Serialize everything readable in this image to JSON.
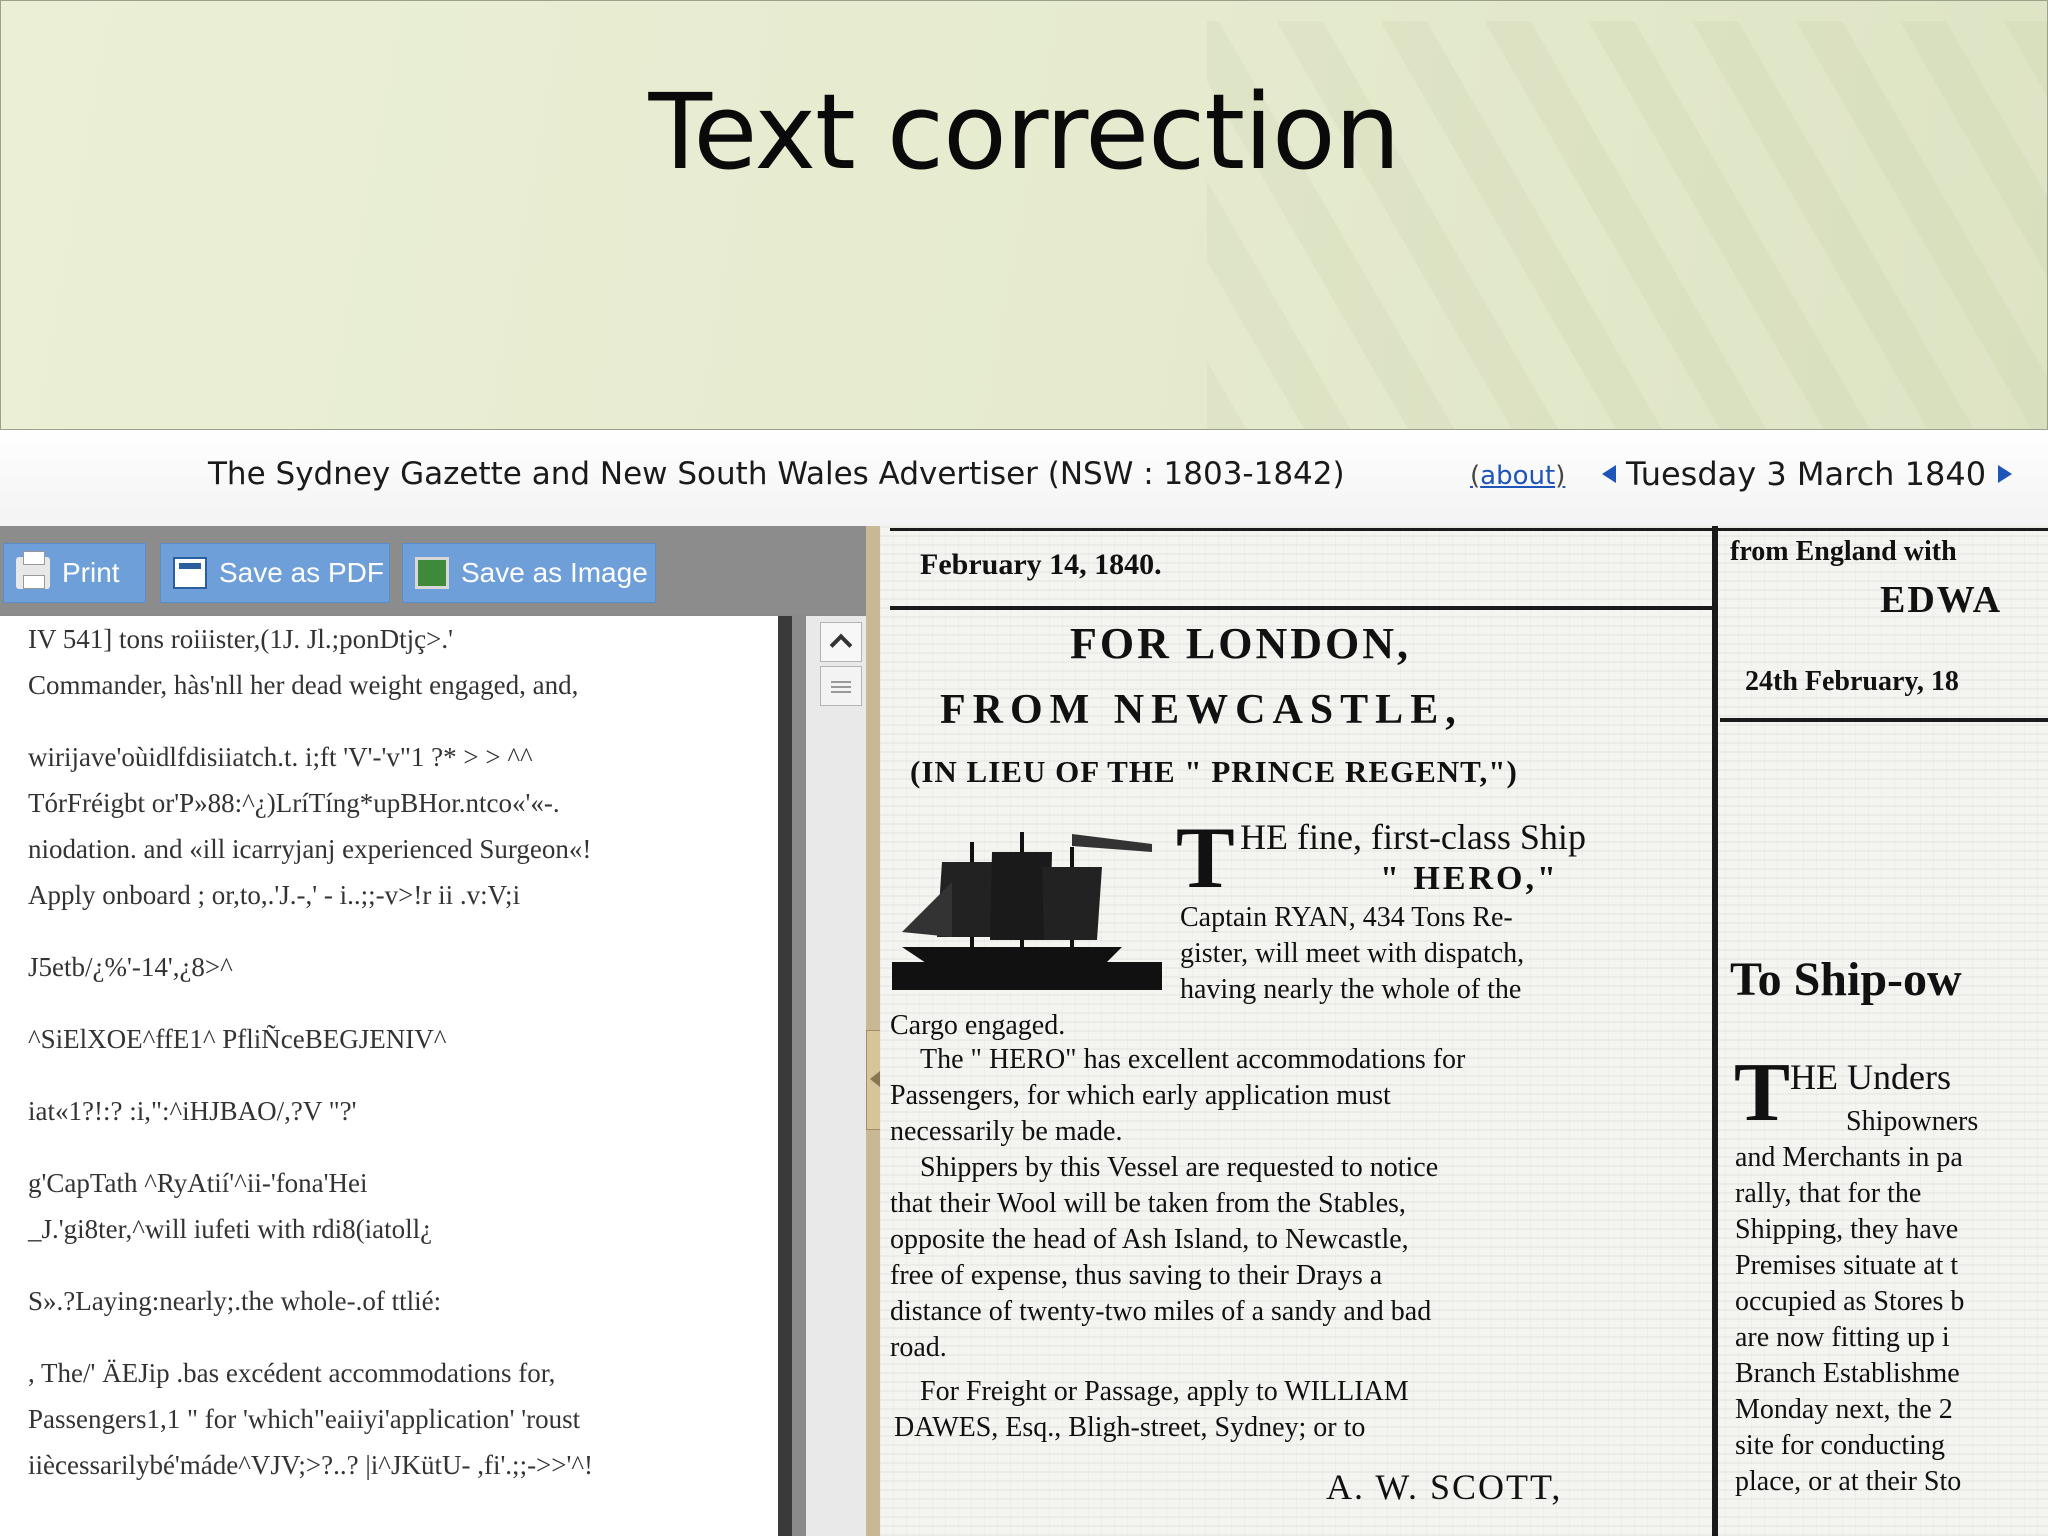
{
  "slide": {
    "title": "Text correction"
  },
  "viewer": {
    "newspaper_title": "The Sydney Gazette and New South Wales Advertiser (NSW : 1803-1842)",
    "about_label": "about",
    "issue_date": "Tuesday 3 March 1840"
  },
  "toolbar": {
    "print_label": "Print",
    "save_pdf_label": "Save as PDF",
    "save_image_label": "Save as Image"
  },
  "ocr_text": {
    "p1": "IV 541] tons roiiister,(1J. Jl.;ponDtjç>.'\nCommander, hàs'nll her dead weight engaged, and,",
    "p2": "wirijave'oùidlfdisiiatch.t. i;ft 'V'-'v\"1 ?* > > ^^\nTórFréigbt or'P»88:^¿)LríTíng*upBHor.ntco«'«-.\nniodation. and «ill icarryjanj experienced Surgeon«!\nApply onboard ; or,to,.'J.-,' - i..;;-v>!r ii .v:V;i",
    "p3": "J5etb/¿%'-14',¿8>^",
    "p4": "^SiElXOE^ffE1^ PfliÑceBEGJENIV^",
    "p5": "iat«1?!:? :i,\":^iHJBAO/,?V \"?'",
    "p6": "g'CapTath ^RyAtií'^ii-'fona'Hei\n_J.'gi8ter,^will iufeti with rdi8(iatoll¿",
    "p7": "S».?Laying:nearly;.the whole-.of ttlié:",
    "p8": ", The/' ÄEJip .bas excédent accommodations for,\nPassengers1,1 \" for 'which\"eaiiyi'application' 'roust\niiècessarilybé'máde^VJV;>?..? |i^JKütU- ,fi'.;;->>'^!"
  },
  "scan": {
    "col1": {
      "date": "February 14, 1840.",
      "h1": "FOR LONDON,",
      "h2": "FROM NEWCASTLE,",
      "h3": "(IN LIEU OF THE \" PRINCE REGENT,\")",
      "lead": "HE fine, first-class Ship",
      "ship": "\" HERO,\"",
      "l1": "Captain RYAN, 434 Tons Re-",
      "l2": "gister, will meet with dispatch,",
      "l3": "having nearly the whole of the",
      "l4": "Cargo engaged.",
      "l5": "The \" HERO\" has excellent accommodations for",
      "l6": "Passengers, for which early application must",
      "l7": "necessarily be made.",
      "l8": "Shippers by this Vessel are requested to notice",
      "l9": "that their Wool will be taken from the Stables,",
      "l10": "opposite the head of Ash Island, to Newcastle,",
      "l11": "free of expense, thus saving to their Drays a",
      "l12": "distance of twenty-two miles of a sandy and bad",
      "l13": "road.",
      "l14": "For Freight or Passage, apply to WILLIAM",
      "l15": "DAWES, Esq., Bligh-street, Sydney; or to",
      "l16": "A. W. SCOTT,"
    },
    "col2": {
      "l1": "from England with",
      "l2": "EDWA",
      "l3": "24th February, 18",
      "h1": "To Ship-ow",
      "lead": "HE Unders",
      "l4": "Shipowners",
      "l5": "and Merchants in pa",
      "l6": "rally, that for the",
      "l7": "Shipping, they have",
      "l8": "Premises situate at t",
      "l9": "occupied as Stores b",
      "l10": "are now fitting up i",
      "l11": "Branch Establishme",
      "l12": "Monday next, the 2",
      "l13": "site for conducting",
      "l14": "place, or at their Sto"
    }
  }
}
